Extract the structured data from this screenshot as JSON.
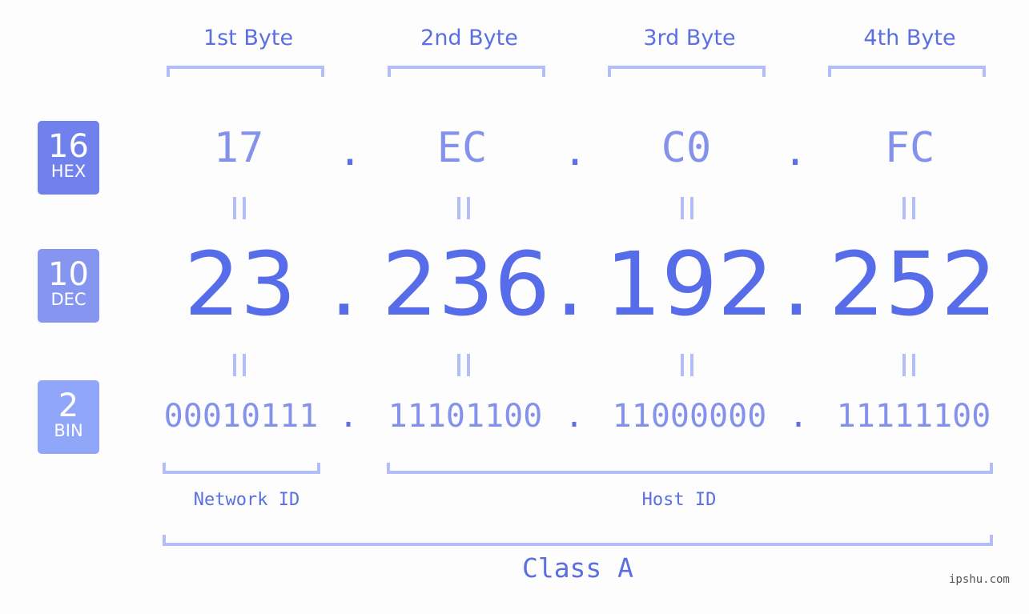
{
  "bases": [
    {
      "num": "16",
      "label": "HEX",
      "color": "#7080ec"
    },
    {
      "num": "10",
      "label": "DEC",
      "color": "#8595f0"
    },
    {
      "num": "2",
      "label": "BIN",
      "color": "#90a6f8"
    }
  ],
  "byte_labels": [
    "1st Byte",
    "2nd Byte",
    "3rd Byte",
    "4th Byte"
  ],
  "hex": [
    "17",
    "EC",
    "C0",
    "FC"
  ],
  "dec": [
    "23",
    "236",
    "192",
    "252"
  ],
  "bin": [
    "00010111",
    "11101100",
    "11000000",
    "11111100"
  ],
  "separator": ".",
  "network_id_label": "Network ID",
  "host_id_label": "Host ID",
  "class_label": "Class A",
  "watermark": "ipshu.com"
}
